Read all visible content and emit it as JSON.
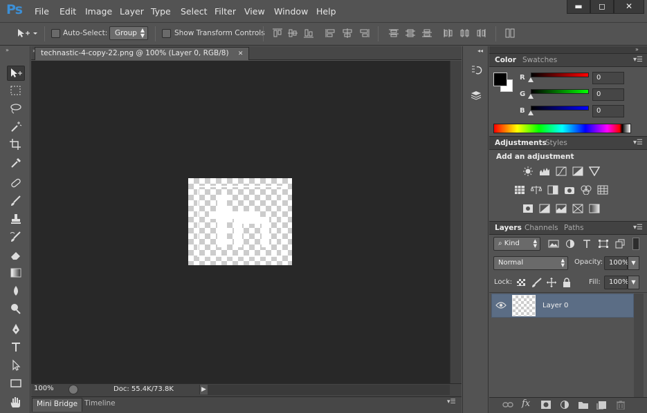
{
  "app": {
    "logo": "Ps"
  },
  "menu": [
    "File",
    "Edit",
    "Image",
    "Layer",
    "Type",
    "Select",
    "Filter",
    "View",
    "Window",
    "Help"
  ],
  "window_controls": {
    "minimize": "▬",
    "restore": "◻",
    "close": "✕"
  },
  "options_bar": {
    "auto_select_label": "Auto-Select:",
    "auto_select_checked": false,
    "group_value": "Group",
    "show_transform_label": "Show Transform Controls",
    "show_transform_checked": false
  },
  "tools": [
    "move-tool",
    "marquee-tool",
    "lasso-tool",
    "magic-wand-tool",
    "crop-tool",
    "eyedropper-tool",
    "healing-brush-tool",
    "brush-tool",
    "clone-stamp-tool",
    "history-brush-tool",
    "eraser-tool",
    "gradient-tool",
    "blur-tool",
    "dodge-tool",
    "pen-tool",
    "type-tool",
    "path-selection-tool",
    "rectangle-tool",
    "hand-tool"
  ],
  "document": {
    "tab_title": "technastic-4-copy-22.png @ 100% (Layer 0, RGB/8)",
    "tab_close": "✕",
    "zoom": "100%",
    "doc_info": "Doc: 55.4K/73.8K"
  },
  "bottom_tabs": [
    "Mini Bridge",
    "Timeline"
  ],
  "color_panel": {
    "tabs": [
      "Color",
      "Swatches"
    ],
    "channels": [
      {
        "label": "R",
        "value": "0",
        "color": "#ff0000"
      },
      {
        "label": "G",
        "value": "0",
        "color": "#00ff00"
      },
      {
        "label": "B",
        "value": "0",
        "color": "#0000ff"
      }
    ],
    "foreground": "#000000",
    "background": "#ffffff"
  },
  "adjustments_panel": {
    "tabs": [
      "Adjustments",
      "Styles"
    ],
    "heading": "Add an adjustment"
  },
  "layers_panel": {
    "tabs": [
      "Layers",
      "Channels",
      "Paths"
    ],
    "filter_kind": "Kind",
    "blend_mode": "Normal",
    "opacity_label": "Opacity:",
    "opacity": "100%",
    "lock_label": "Lock:",
    "fill_label": "Fill:",
    "fill": "100%",
    "layers": [
      {
        "name": "Layer 0",
        "visible": true,
        "selected": true
      }
    ]
  }
}
